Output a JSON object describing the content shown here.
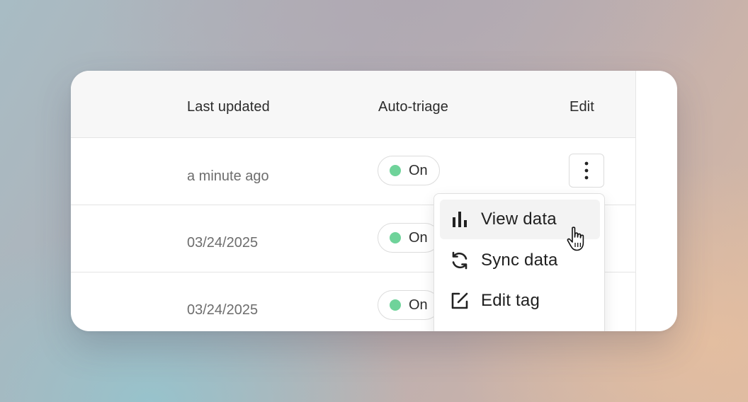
{
  "table": {
    "columns": {
      "last_updated": "Last updated",
      "auto_triage": "Auto-triage",
      "edit": "Edit"
    },
    "rows": [
      {
        "last_updated": "a minute ago",
        "auto_triage": "On"
      },
      {
        "last_updated": "03/24/2025",
        "auto_triage": "On"
      },
      {
        "last_updated": "03/24/2025",
        "auto_triage": "On"
      }
    ]
  },
  "menu": {
    "items": [
      {
        "label": "View data",
        "icon": "bar-chart-icon"
      },
      {
        "label": "Sync data",
        "icon": "sync-icon"
      },
      {
        "label": "Edit tag",
        "icon": "edit-square-icon"
      }
    ]
  },
  "colors": {
    "status_on": "#6fd39a",
    "header_bg": "#f7f7f7",
    "hover_bg": "#f3f3f3"
  }
}
